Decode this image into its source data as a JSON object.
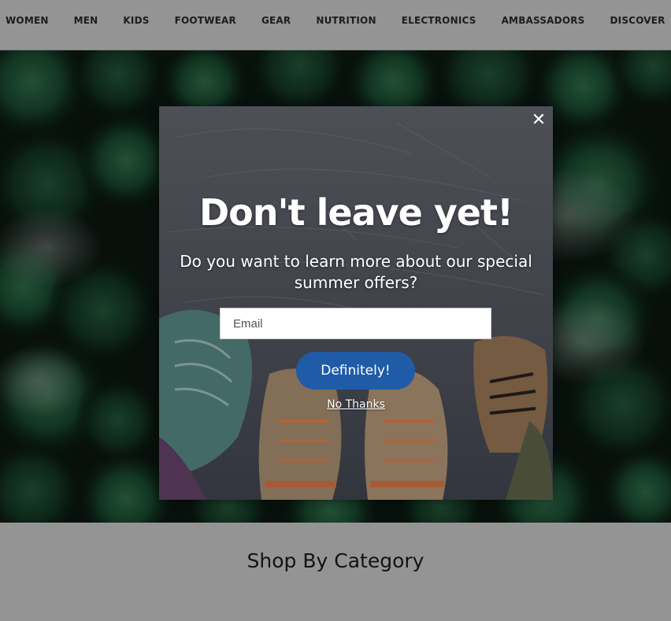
{
  "nav": {
    "items": [
      {
        "label": "WOMEN"
      },
      {
        "label": "MEN"
      },
      {
        "label": "KIDS"
      },
      {
        "label": "FOOTWEAR"
      },
      {
        "label": "GEAR"
      },
      {
        "label": "NUTRITION"
      },
      {
        "label": "ELECTRONICS"
      },
      {
        "label": "AMBASSADORS"
      },
      {
        "label": "DISCOVER"
      }
    ]
  },
  "section": {
    "title": "Shop By Category"
  },
  "modal": {
    "close_glyph": "✕",
    "heading": "Don't leave yet!",
    "subheading": "Do you want to learn more about our special summer offers?",
    "email_placeholder": "Email",
    "email_value": "",
    "cta_label": "Definitely!",
    "dismiss_label": "No Thanks"
  },
  "colors": {
    "cta_background": "#1f5ba7",
    "forest_green": "#1f5a3a",
    "overlay": "rgba(0,0,0,0.42)"
  },
  "icons": {
    "close": "close-icon"
  }
}
